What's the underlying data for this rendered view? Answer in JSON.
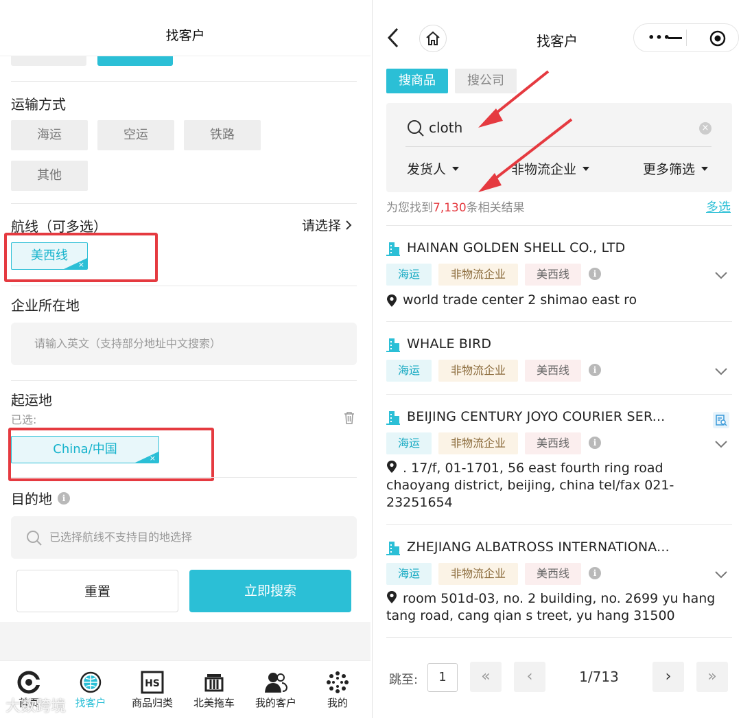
{
  "left": {
    "title": "找客户",
    "transport": {
      "label": "运输方式",
      "options": [
        "海运",
        "空运",
        "铁路",
        "其他"
      ]
    },
    "route": {
      "label": "航线（可多选）",
      "action": "请选择",
      "selected": "美西线",
      "remove_glyph": "×"
    },
    "location": {
      "label": "企业所在地",
      "placeholder": "请输入英文（支持部分地址中文搜索）"
    },
    "origin": {
      "label": "起运地",
      "selected_label": "已选:",
      "selected": "China/中国",
      "remove_glyph": "×"
    },
    "destination": {
      "label": "目的地",
      "info_glyph": "i",
      "placeholder": "已选择航线不支持目的地选择"
    },
    "buttons": {
      "reset": "重置",
      "search": "立即搜索"
    },
    "nav": [
      {
        "label": "首页",
        "icon": "home-logo-icon"
      },
      {
        "label": "找客户",
        "icon": "globe-icon"
      },
      {
        "label": "商品归类",
        "icon": "hs-code-icon"
      },
      {
        "label": "北美拖车",
        "icon": "truck-icon"
      },
      {
        "label": "我的客户",
        "icon": "customers-icon"
      },
      {
        "label": "我的",
        "icon": "profile-icon"
      }
    ],
    "watermark": "大数跨境"
  },
  "right": {
    "title": "找客户",
    "capsule": {
      "more": "•••",
      "minimize": "—"
    },
    "tabs": [
      "搜商品",
      "搜公司"
    ],
    "search": {
      "value": "cloth",
      "clear_glyph": "×"
    },
    "filters": [
      "发货人",
      "非物流企业",
      "更多筛选"
    ],
    "result": {
      "prefix": "为您找到",
      "count": "7,130",
      "suffix": "条相关结果",
      "multi_select": "多选"
    },
    "companies": [
      {
        "name": "HAINAN GOLDEN SHELL CO., LTD",
        "tags": [
          "海运",
          "非物流企业",
          "美西线"
        ],
        "address": [
          "world trade center 2 shimao east ro"
        ]
      },
      {
        "name": "WHALE BIRD",
        "tags": [
          "海运",
          "非物流企业",
          "美西线"
        ],
        "address": []
      },
      {
        "name": "BEIJING CENTURY JOYO COURIER SER...",
        "tags": [
          "海运",
          "非物流企业",
          "美西线"
        ],
        "address": [
          ". 17/f, 01-1701, 56 east fourth ring road",
          "chaoyang district, beijing, china tel/fax 021-",
          "23251654"
        ]
      },
      {
        "name": "ZHEJIANG ALBATROSS INTERNATIONA...",
        "tags": [
          "海运",
          "非物流企业",
          "美西线"
        ],
        "address": [
          "room 501d-03, no. 2 building, no. 2699 yu hang",
          "tang road, cang qian s treet, yu hang 31500"
        ]
      }
    ],
    "info_glyph": "i",
    "pagination": {
      "jump_label": "跳至:",
      "jump_value": "1",
      "page": "1/713",
      "first": "«",
      "prev": "‹",
      "next": "›",
      "last": "»"
    }
  },
  "colors": {
    "accent": "#2bbfd6",
    "highlight": "#e53a40",
    "count": "#e53a40"
  }
}
